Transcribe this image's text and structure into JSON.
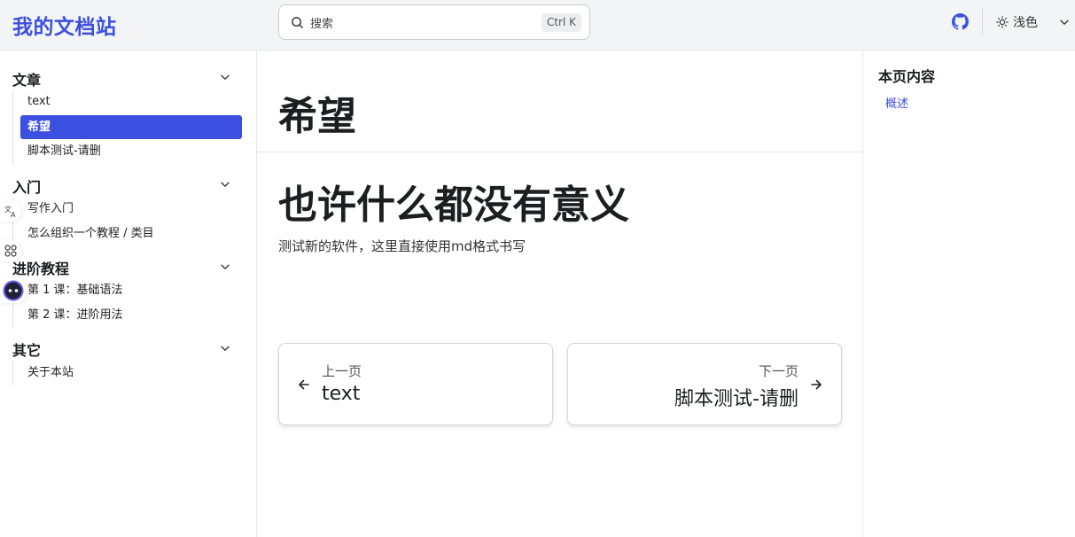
{
  "header": {
    "site_title": "我的文档站",
    "search_placeholder": "搜索",
    "search_shortcut": "Ctrl K",
    "theme_label": "浅色"
  },
  "sidebar": {
    "categories": [
      {
        "title": "文章",
        "items": [
          "text",
          "希望",
          "脚本测试-请删"
        ]
      },
      {
        "title": "入门",
        "items": [
          "写作入门",
          "怎么组织一个教程 / 类目"
        ]
      },
      {
        "title": "进阶教程",
        "items": [
          "第 1 课：基础语法",
          "第 2 课：进阶用法"
        ]
      },
      {
        "title": "其它",
        "items": [
          "关于本站"
        ]
      }
    ],
    "active_item": "希望"
  },
  "main": {
    "page_title": "希望",
    "heading": "也许什么都没有意义",
    "paragraph": "测试新的软件，这里直接使用md格式书写",
    "prev": {
      "sub": "上一页",
      "label": "text"
    },
    "next": {
      "sub": "下一页",
      "label": "脚本测试-请删"
    }
  },
  "toc": {
    "title": "本页内容",
    "links": [
      "概述"
    ]
  },
  "colors": {
    "accent": "#3b4fe0",
    "header_bg": "#f3f4f6",
    "text": "#1c1e21"
  },
  "icons": [
    "search-icon",
    "github-icon",
    "sun-icon",
    "chevron-down-icon",
    "translate-icon",
    "apps-icon",
    "assistant-icon",
    "arrow-left-icon",
    "arrow-right-icon"
  ]
}
